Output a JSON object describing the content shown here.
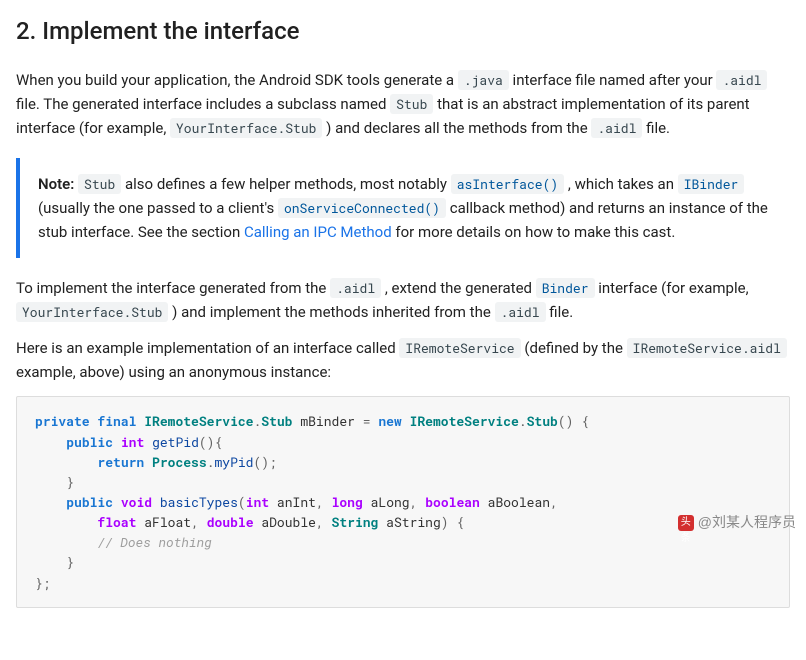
{
  "heading": "2. Implement the interface",
  "p1": {
    "t1": "When you build your application, the Android SDK tools generate a ",
    "c1": ".java",
    "t2": " interface file named after your ",
    "c2": ".aidl",
    "t3": " file. The generated interface includes a subclass named ",
    "c3": "Stub",
    "t4": " that is an abstract implementation of its parent interface (for example, ",
    "c4": "YourInterface.Stub",
    "t5": ") and declares all the methods from the ",
    "c5": ".aidl",
    "t6": " file."
  },
  "note": {
    "label": "Note:",
    "t1": " ",
    "c1": "Stub",
    "t2": " also defines a few helper methods, most notably ",
    "c2": "asInterface()",
    "t3": ", which takes an ",
    "c3": "IBinder",
    "t4": " (usually the one passed to a client's ",
    "c4": "onServiceConnected()",
    "t5": " callback method) and returns an instance of the stub interface. See the section ",
    "link": "Calling an IPC Method",
    "t6": " for more details on how to make this cast."
  },
  "p2": {
    "t1": "To implement the interface generated from the ",
    "c1": ".aidl",
    "t2": ", extend the generated ",
    "c2": "Binder",
    "t3": " interface (for example, ",
    "c3": "YourInterface.Stub",
    "t4": ") and implement the methods inherited from the ",
    "c4": ".aidl",
    "t5": " file."
  },
  "p3": {
    "t1": "Here is an example implementation of an interface called ",
    "c1": "IRemoteService",
    "t2": " (defined by the ",
    "c2": "IRemoteService.aidl",
    "t3": " example, above) using an anonymous instance:"
  },
  "code": {
    "kw_private": "private",
    "kw_final": "final",
    "kw_new": "new",
    "kw_public": "public",
    "kw_return": "return",
    "ty_IRemoteService": "IRemoteService",
    "ty_Stub": "Stub",
    "ty_Process": "Process",
    "ty_String": "String",
    "pr_int": "int",
    "pr_void": "void",
    "pr_long": "long",
    "pr_boolean": "boolean",
    "pr_float": "float",
    "pr_double": "double",
    "id_mBinder": "mBinder",
    "id_anInt": "anInt",
    "id_aLong": "aLong",
    "id_aBoolean": "aBoolean",
    "id_aFloat": "aFloat",
    "id_aDouble": "aDouble",
    "id_aString": "aString",
    "fn_getPid": "getPid",
    "fn_myPid": "myPid",
    "fn_basicTypes": "basicTypes",
    "cmt": "// Does nothing"
  },
  "watermark": {
    "logo": "头条",
    "text": "@刘某人程序员"
  }
}
